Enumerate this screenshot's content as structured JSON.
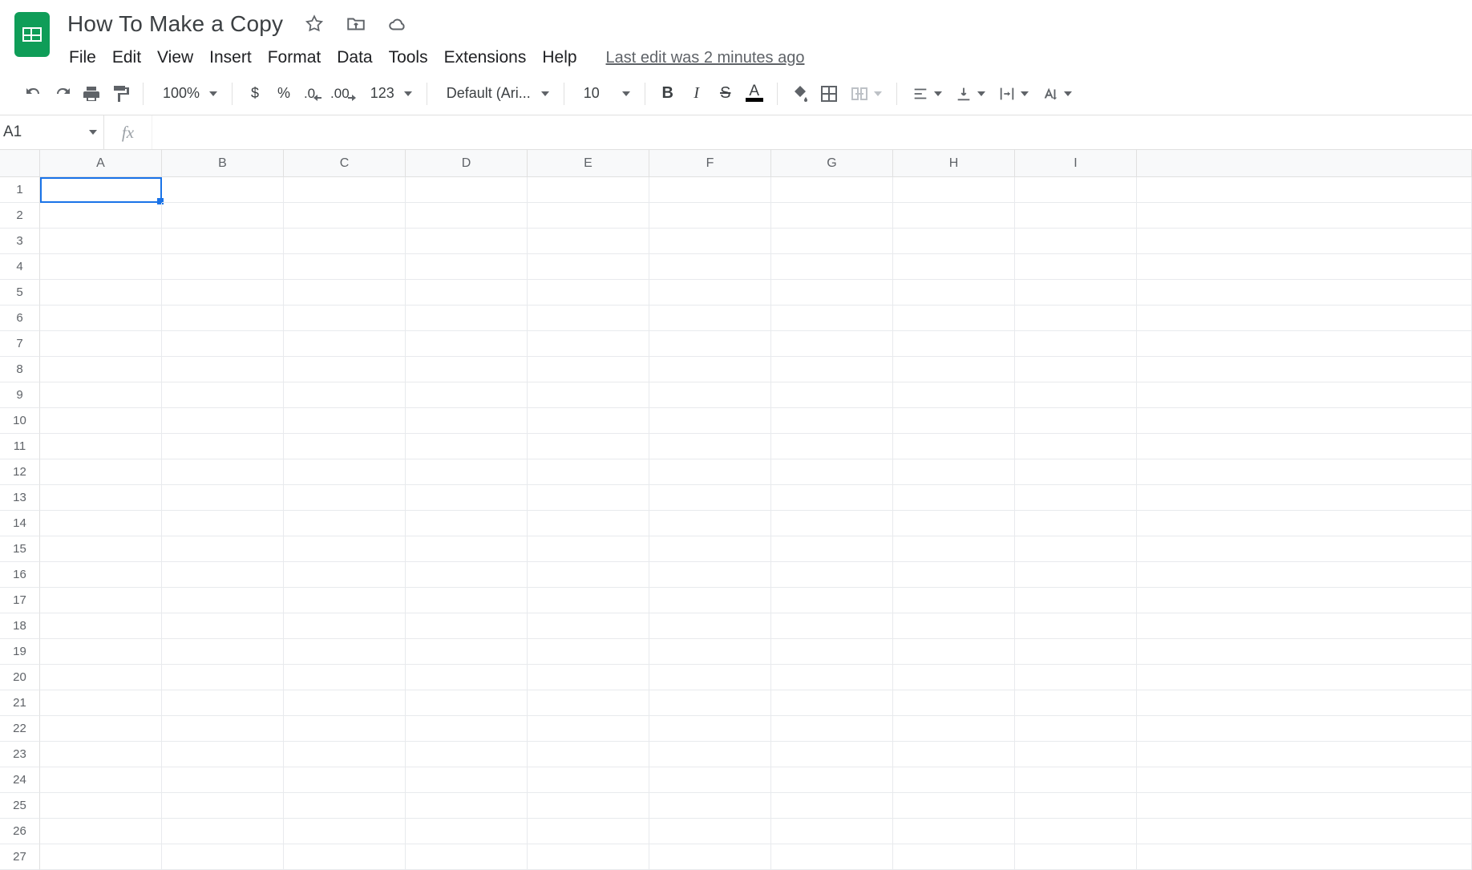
{
  "doc": {
    "title": "How To Make a Copy"
  },
  "menus": [
    "File",
    "Edit",
    "View",
    "Insert",
    "Format",
    "Data",
    "Tools",
    "Extensions",
    "Help"
  ],
  "last_edit": "Last edit was 2 minutes ago",
  "toolbar": {
    "zoom": "100%",
    "currency": "$",
    "percent": "%",
    "dec_dec": ".0",
    "inc_dec": ".00",
    "numfmt": "123",
    "font": "Default (Ari...",
    "size": "10",
    "bold": "B",
    "italic": "I",
    "strike": "S",
    "textcolor": "A"
  },
  "namebox": "A1",
  "fx": "fx",
  "columns": [
    "A",
    "B",
    "C",
    "D",
    "E",
    "F",
    "G",
    "H",
    "I"
  ],
  "rows": [
    "1",
    "2",
    "3",
    "4",
    "5",
    "6",
    "7",
    "8",
    "9",
    "10",
    "11",
    "12",
    "13",
    "14",
    "15",
    "16",
    "17",
    "18",
    "19",
    "20",
    "21",
    "22",
    "23",
    "24",
    "25",
    "26",
    "27"
  ],
  "selected_cell": "A1"
}
